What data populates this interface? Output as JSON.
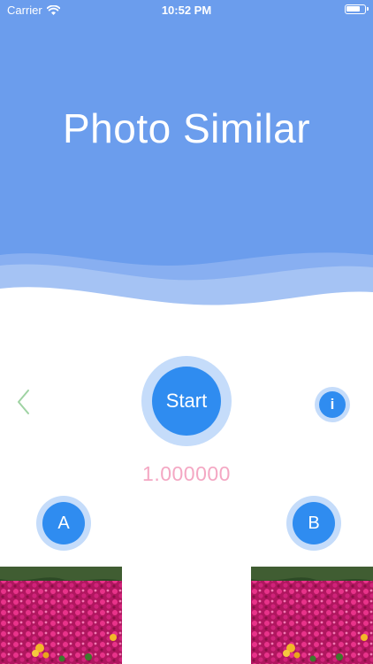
{
  "status_bar": {
    "carrier": "Carrier",
    "time": "10:52 PM"
  },
  "header": {
    "title": "Photo Similar",
    "background_color": "#6b9ded"
  },
  "controls": {
    "back_icon": "chevron-left-icon",
    "start_label": "Start",
    "info_label": "i",
    "button_color": "#2f8cf0",
    "ring_color": "#c5dcfa"
  },
  "result": {
    "similarity": "1.000000",
    "color": "#f4a7c3"
  },
  "photos": {
    "a_label": "A",
    "b_label": "B",
    "a_image": "flower-bed-photo",
    "b_image": "flower-bed-photo"
  }
}
